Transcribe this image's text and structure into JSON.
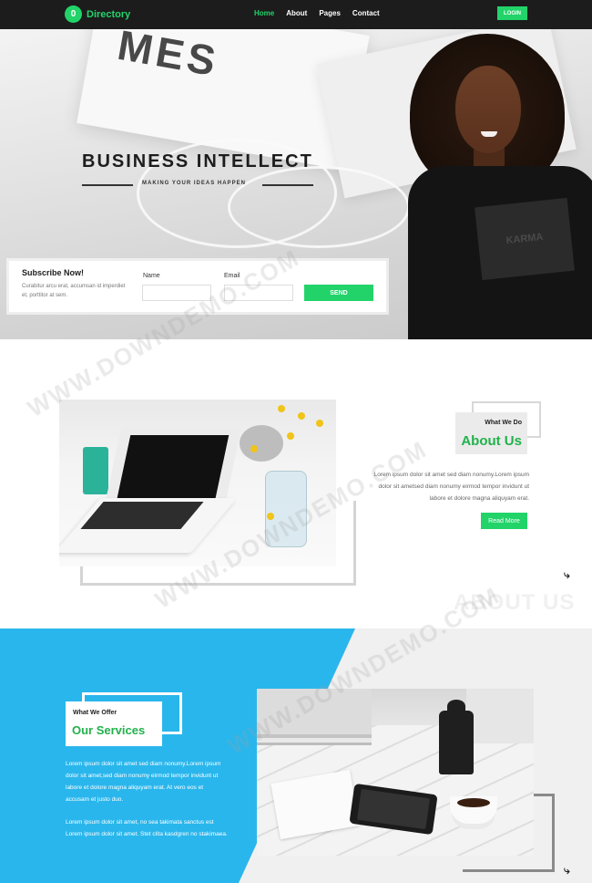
{
  "nav": {
    "logo_badge": "0",
    "logo_text": "Directory",
    "links": [
      "Home",
      "About",
      "Pages",
      "Contact"
    ],
    "login_label": "LOGIN"
  },
  "hero": {
    "title": "BUSINESS INTELLECT",
    "subtitle": "MAKING YOUR IDEAS HAPPEN",
    "paper_text": "MES",
    "shirt_text": "KARMA"
  },
  "subscribe": {
    "title": "Subscribe Now!",
    "description": "Curabitur arcu erat, accumsan id imperdiet et, porttitor at sem.",
    "name_label": "Name",
    "email_label": "Email",
    "send_label": "SEND"
  },
  "about": {
    "kicker": "What We Do",
    "heading": "About Us",
    "text": "Lorem ipsum dolor sit amet sed diam nonumy.Lorem ipsum dolor sit ametsed diam nonumy eirmod tempor invidunt ut labore et dolore magna aliquyam erat.",
    "button_label": "Read More",
    "watermark": "ABOUT US"
  },
  "services": {
    "kicker": "What We Offer",
    "heading": "Our Services",
    "text_1": "Lorem ipsum dolor sit amet sed diam nonumy.Lorem ipsum dolor sit amet,sed diam nonumy eirmod tempor invidunt ut labore et dolore magna aliquyam erat. At vero eos et accusam et justo duo.",
    "text_2": "Lorem ipsum dolor sit amet, no sea takimata sanctus est Lorem ipsum dolor sit amet. Stet clita kasdgren no stakimaea."
  },
  "watermark_text": "WWW.DOWNDEMO.COM",
  "colors": {
    "accent_green": "#22d36a",
    "heading_green": "#22b14c",
    "nav_bg": "#1c1c1c",
    "services_blue": "#29b6ec"
  },
  "icons": [
    "scroll-mark-icon"
  ]
}
